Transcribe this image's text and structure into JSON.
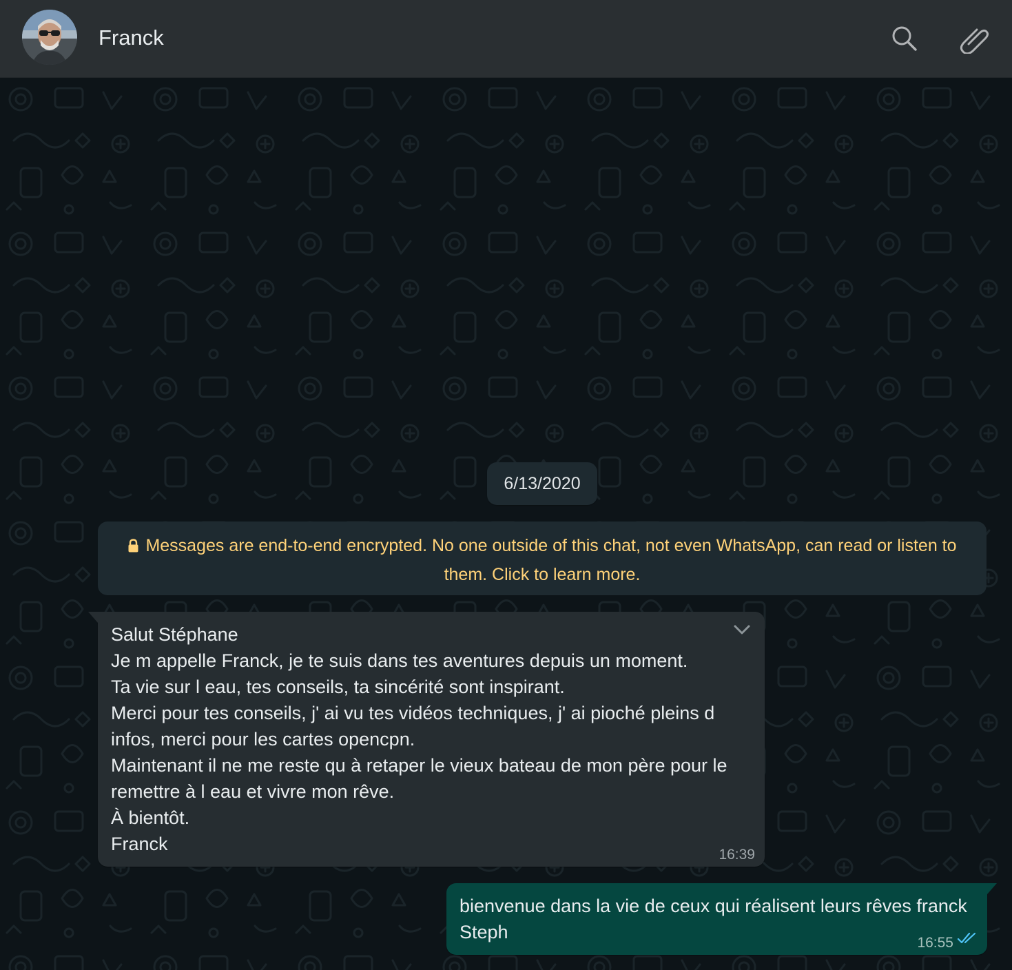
{
  "header": {
    "contact_name": "Franck",
    "avatar_icon": "contact-avatar-photo",
    "search_icon": "search-icon",
    "attach_icon": "paperclip-icon"
  },
  "chat": {
    "date_chip": "6/13/2020",
    "encryption_notice": {
      "lines": [
        "Messages are end-to-end encrypted. No one outside of this chat, not even WhatsApp, can read or listen to",
        "them. Click to learn more."
      ],
      "icon": "lock-icon",
      "color": "#ffd279"
    },
    "messages": [
      {
        "direction": "incoming",
        "lines": [
          "Salut Stéphane",
          "Je m appelle Franck, je te suis dans tes aventures depuis un moment.",
          "Ta vie sur l eau, tes conseils, ta sincérité sont inspirant.",
          "Merci pour tes conseils, j' ai vu tes vidéos techniques, j' ai pioché pleins d",
          "infos, merci pour les cartes opencpn.",
          "Maintenant il ne me reste qu à retaper le vieux bateau de mon père pour le",
          "remettre à l eau et vivre mon rêve.",
          "À bientôt.",
          "Franck"
        ],
        "time": "16:39",
        "menu_icon": "chevron-down-icon"
      },
      {
        "direction": "outgoing",
        "lines": [
          "bienvenue dans la vie de ceux qui réalisent leurs rêves franck",
          "Steph"
        ],
        "time": "16:55",
        "status_icon": "double-check-read-icon",
        "status_color": "#4fc3f7"
      }
    ]
  },
  "colors": {
    "header_bg": "#2a2f32",
    "chat_bg": "#0d1418",
    "incoming_bubble": "#262d31",
    "outgoing_bubble": "#054740",
    "system_bubble": "#1e2a30"
  }
}
